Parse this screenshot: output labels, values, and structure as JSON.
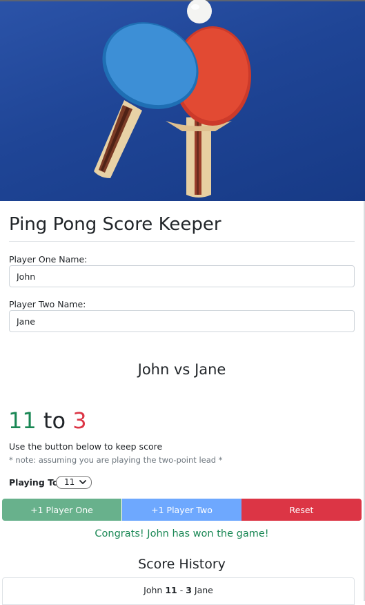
{
  "app": {
    "title": "Ping Pong Score Keeper",
    "hero_image": "ping-pong-paddles-photo"
  },
  "form": {
    "player_one_label": "Player One Name:",
    "player_one_value": "John",
    "player_two_label": "Player Two Name:",
    "player_two_value": "Jane"
  },
  "match": {
    "player_one": "John",
    "vs": "vs",
    "player_two": "Jane"
  },
  "score": {
    "player_one": "11",
    "separator": "to",
    "player_two": "3"
  },
  "instructions": {
    "hint": "Use the button below to keep score",
    "note": "* note: assuming you are playing the two-point lead *"
  },
  "playing_to": {
    "label": "Playing To",
    "selected": "11"
  },
  "buttons": {
    "player_one": "+1 Player One",
    "player_two": "+1 Player Two",
    "reset": "Reset"
  },
  "status": {
    "message": "Congrats! John has won the game!"
  },
  "history": {
    "title": "Score History",
    "items": [
      {
        "player_one": "John",
        "score_one": "11",
        "dash": "-",
        "score_two": "3",
        "player_two": "Jane"
      }
    ]
  },
  "colors": {
    "win_green": "#198754",
    "lose_red": "#dc3545",
    "button_one": "#68b18c",
    "button_two": "#6ea8fe",
    "button_reset": "#dc3545",
    "hero_blue": "#1f4596"
  }
}
